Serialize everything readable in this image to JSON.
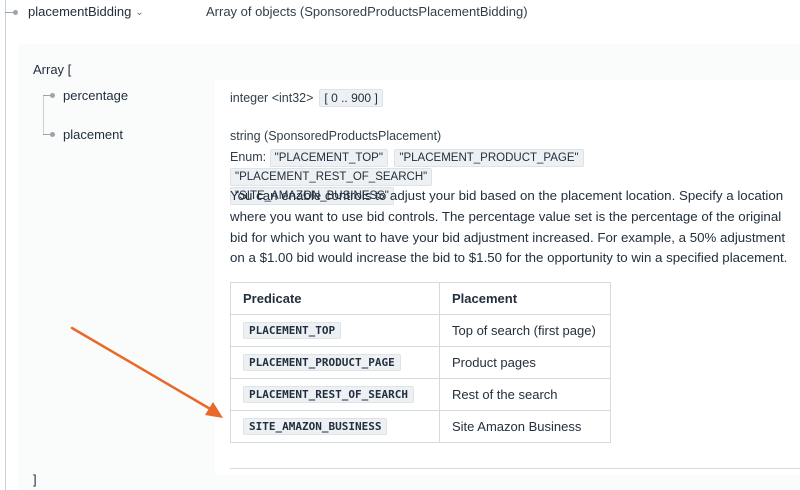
{
  "field": {
    "name": "placementBidding",
    "type": "Array of objects (SponsoredProductsPlacementBidding)"
  },
  "array": {
    "open": "Array [",
    "close": "]"
  },
  "properties": {
    "percentage": {
      "name": "percentage",
      "type": "integer <int32>",
      "range": "[ 0 .. 900 ]"
    },
    "placement": {
      "name": "placement",
      "type": "string (SponsoredProductsPlacement)",
      "enum_label": "Enum:",
      "enum_values": [
        "\"PLACEMENT_TOP\"",
        "\"PLACEMENT_PRODUCT_PAGE\"",
        "\"PLACEMENT_REST_OF_SEARCH\"",
        "\"SITE_AMAZON_BUSINESS\""
      ],
      "description": "You can enable controls to adjust your bid based on the placement location. Specify a location where you want to use bid controls. The percentage value set is the percentage of the original bid for which you want to have your bid adjustment increased. For example, a 50% adjustment on a $1.00 bid would increase the bid to $1.50 for the opportunity to win a specified placement."
    }
  },
  "table": {
    "headers": [
      "Predicate",
      "Placement"
    ],
    "rows": [
      [
        "PLACEMENT_TOP",
        "Top of search (first page)"
      ],
      [
        "PLACEMENT_PRODUCT_PAGE",
        "Product pages"
      ],
      [
        "PLACEMENT_REST_OF_SEARCH",
        "Rest of the search"
      ],
      [
        "SITE_AMAZON_BUSINESS",
        "Site Amazon Business"
      ]
    ]
  },
  "icons": {
    "expand": "chevron-down-icon",
    "annotation": "arrow-annotation-icon"
  },
  "colors": {
    "annotation_arrow": "#e8692a",
    "code_bg": "#eef1f3",
    "border": "#d5dbdb"
  }
}
